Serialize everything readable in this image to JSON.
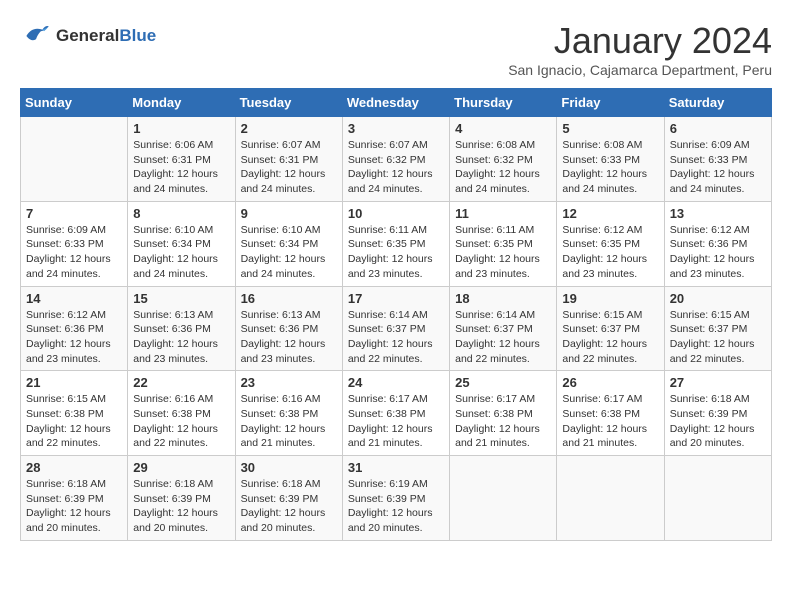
{
  "header": {
    "logo_line1": "General",
    "logo_line2": "Blue",
    "title": "January 2024",
    "subtitle": "San Ignacio, Cajamarca Department, Peru"
  },
  "days_of_week": [
    "Sunday",
    "Monday",
    "Tuesday",
    "Wednesday",
    "Thursday",
    "Friday",
    "Saturday"
  ],
  "weeks": [
    [
      {
        "day": "",
        "info": ""
      },
      {
        "day": "1",
        "info": "Sunrise: 6:06 AM\nSunset: 6:31 PM\nDaylight: 12 hours\nand 24 minutes."
      },
      {
        "day": "2",
        "info": "Sunrise: 6:07 AM\nSunset: 6:31 PM\nDaylight: 12 hours\nand 24 minutes."
      },
      {
        "day": "3",
        "info": "Sunrise: 6:07 AM\nSunset: 6:32 PM\nDaylight: 12 hours\nand 24 minutes."
      },
      {
        "day": "4",
        "info": "Sunrise: 6:08 AM\nSunset: 6:32 PM\nDaylight: 12 hours\nand 24 minutes."
      },
      {
        "day": "5",
        "info": "Sunrise: 6:08 AM\nSunset: 6:33 PM\nDaylight: 12 hours\nand 24 minutes."
      },
      {
        "day": "6",
        "info": "Sunrise: 6:09 AM\nSunset: 6:33 PM\nDaylight: 12 hours\nand 24 minutes."
      }
    ],
    [
      {
        "day": "7",
        "info": "Sunrise: 6:09 AM\nSunset: 6:33 PM\nDaylight: 12 hours\nand 24 minutes."
      },
      {
        "day": "8",
        "info": "Sunrise: 6:10 AM\nSunset: 6:34 PM\nDaylight: 12 hours\nand 24 minutes."
      },
      {
        "day": "9",
        "info": "Sunrise: 6:10 AM\nSunset: 6:34 PM\nDaylight: 12 hours\nand 24 minutes."
      },
      {
        "day": "10",
        "info": "Sunrise: 6:11 AM\nSunset: 6:35 PM\nDaylight: 12 hours\nand 23 minutes."
      },
      {
        "day": "11",
        "info": "Sunrise: 6:11 AM\nSunset: 6:35 PM\nDaylight: 12 hours\nand 23 minutes."
      },
      {
        "day": "12",
        "info": "Sunrise: 6:12 AM\nSunset: 6:35 PM\nDaylight: 12 hours\nand 23 minutes."
      },
      {
        "day": "13",
        "info": "Sunrise: 6:12 AM\nSunset: 6:36 PM\nDaylight: 12 hours\nand 23 minutes."
      }
    ],
    [
      {
        "day": "14",
        "info": "Sunrise: 6:12 AM\nSunset: 6:36 PM\nDaylight: 12 hours\nand 23 minutes."
      },
      {
        "day": "15",
        "info": "Sunrise: 6:13 AM\nSunset: 6:36 PM\nDaylight: 12 hours\nand 23 minutes."
      },
      {
        "day": "16",
        "info": "Sunrise: 6:13 AM\nSunset: 6:36 PM\nDaylight: 12 hours\nand 23 minutes."
      },
      {
        "day": "17",
        "info": "Sunrise: 6:14 AM\nSunset: 6:37 PM\nDaylight: 12 hours\nand 22 minutes."
      },
      {
        "day": "18",
        "info": "Sunrise: 6:14 AM\nSunset: 6:37 PM\nDaylight: 12 hours\nand 22 minutes."
      },
      {
        "day": "19",
        "info": "Sunrise: 6:15 AM\nSunset: 6:37 PM\nDaylight: 12 hours\nand 22 minutes."
      },
      {
        "day": "20",
        "info": "Sunrise: 6:15 AM\nSunset: 6:37 PM\nDaylight: 12 hours\nand 22 minutes."
      }
    ],
    [
      {
        "day": "21",
        "info": "Sunrise: 6:15 AM\nSunset: 6:38 PM\nDaylight: 12 hours\nand 22 minutes."
      },
      {
        "day": "22",
        "info": "Sunrise: 6:16 AM\nSunset: 6:38 PM\nDaylight: 12 hours\nand 22 minutes."
      },
      {
        "day": "23",
        "info": "Sunrise: 6:16 AM\nSunset: 6:38 PM\nDaylight: 12 hours\nand 21 minutes."
      },
      {
        "day": "24",
        "info": "Sunrise: 6:17 AM\nSunset: 6:38 PM\nDaylight: 12 hours\nand 21 minutes."
      },
      {
        "day": "25",
        "info": "Sunrise: 6:17 AM\nSunset: 6:38 PM\nDaylight: 12 hours\nand 21 minutes."
      },
      {
        "day": "26",
        "info": "Sunrise: 6:17 AM\nSunset: 6:38 PM\nDaylight: 12 hours\nand 21 minutes."
      },
      {
        "day": "27",
        "info": "Sunrise: 6:18 AM\nSunset: 6:39 PM\nDaylight: 12 hours\nand 20 minutes."
      }
    ],
    [
      {
        "day": "28",
        "info": "Sunrise: 6:18 AM\nSunset: 6:39 PM\nDaylight: 12 hours\nand 20 minutes."
      },
      {
        "day": "29",
        "info": "Sunrise: 6:18 AM\nSunset: 6:39 PM\nDaylight: 12 hours\nand 20 minutes."
      },
      {
        "day": "30",
        "info": "Sunrise: 6:18 AM\nSunset: 6:39 PM\nDaylight: 12 hours\nand 20 minutes."
      },
      {
        "day": "31",
        "info": "Sunrise: 6:19 AM\nSunset: 6:39 PM\nDaylight: 12 hours\nand 20 minutes."
      },
      {
        "day": "",
        "info": ""
      },
      {
        "day": "",
        "info": ""
      },
      {
        "day": "",
        "info": ""
      }
    ]
  ]
}
